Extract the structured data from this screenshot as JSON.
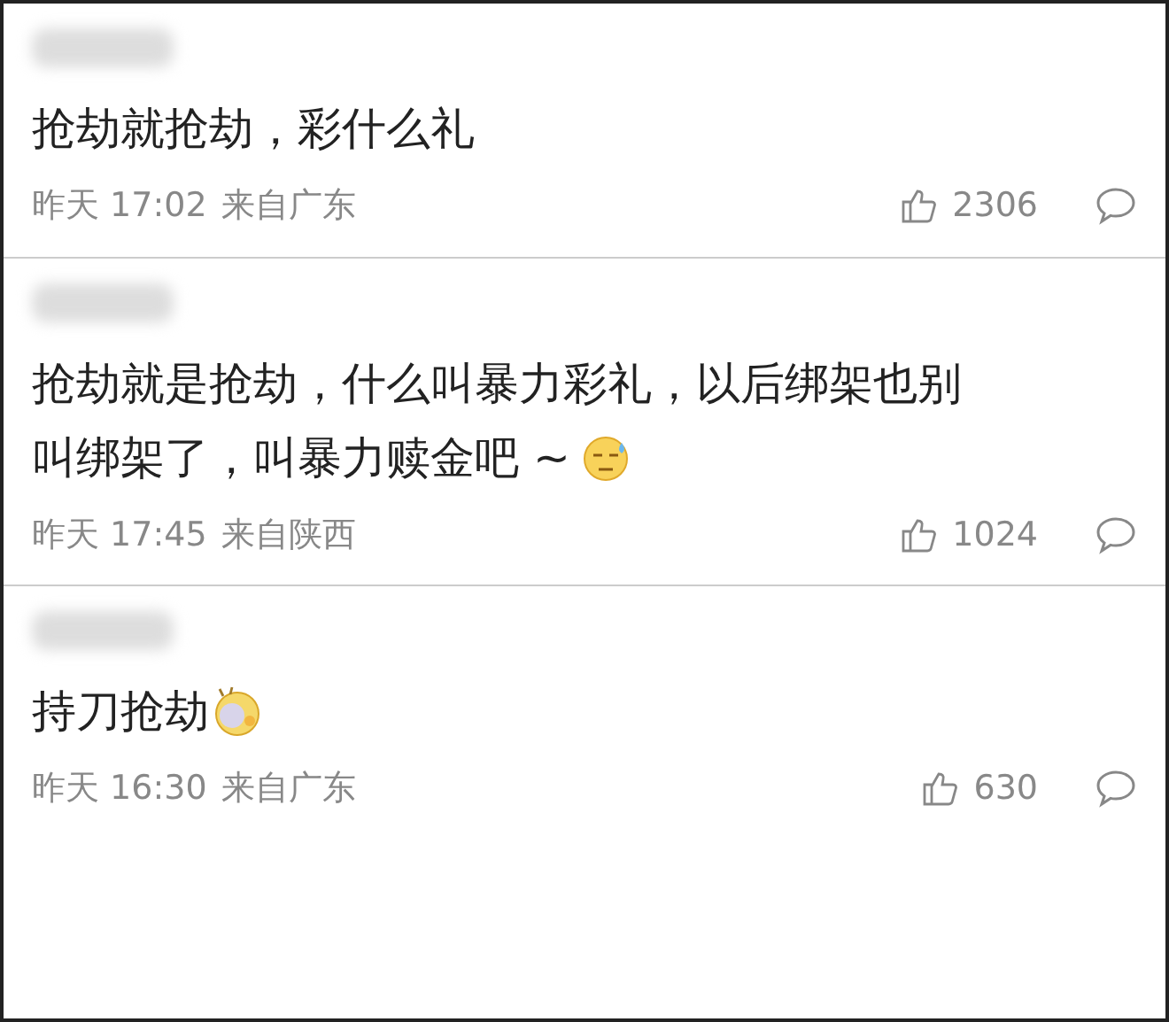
{
  "comments": [
    {
      "kind": "plain",
      "lines": [
        "抢劫就抢劫，彩什么礼"
      ],
      "time": "昨天 17:02",
      "location": "来自广东",
      "likes": "2306"
    },
    {
      "kind": "sweat",
      "lines": [
        "抢劫就是抢劫，什么叫暴力彩礼，以后绑架也别",
        "叫绑架了，叫暴力赎金吧 ~"
      ],
      "time": "昨天 17:45",
      "location": "来自陕西",
      "likes": "1024"
    },
    {
      "kind": "dizzy",
      "lines": [
        "持刀抢劫"
      ],
      "time": "昨天 16:30",
      "location": "来自广东",
      "likes": "630"
    }
  ]
}
